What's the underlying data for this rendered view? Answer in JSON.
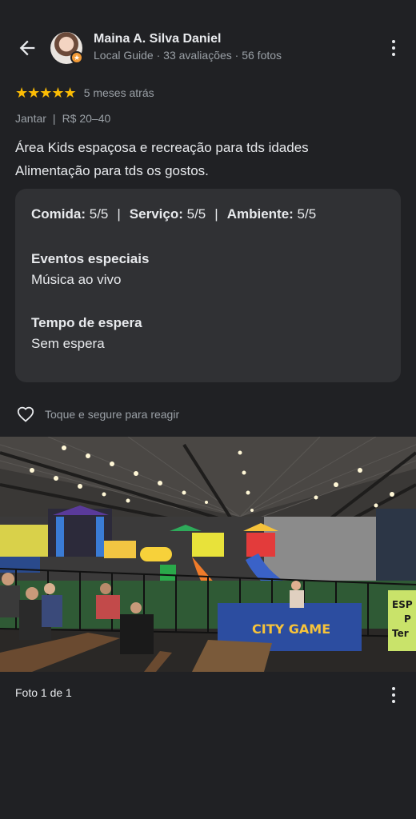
{
  "reviewer": {
    "name": "Maina A. Silva Daniel",
    "meta": "Local Guide · 33 avaliações · 56 fotos"
  },
  "icons": {
    "back": "arrow-back-icon",
    "more": "more-vertical-icon",
    "heart": "heart-outline-icon",
    "badge": "local-guide-star-icon"
  },
  "rating": {
    "stars_text": "★★★★★",
    "stars": 5,
    "max_stars": 5,
    "time": "5 meses atrás"
  },
  "tags": {
    "meal": "Jantar",
    "separator": "|",
    "price": "R$ 20–40"
  },
  "review_text": {
    "line1": "Área Kids espaçosa e recreação para tds idades",
    "line2": "Alimentação para tds os gostos."
  },
  "scores": {
    "food_label": "Comida:",
    "food_value": "5/5",
    "service_label": "Serviço:",
    "service_value": "5/5",
    "atmosphere_label": "Ambiente:",
    "atmosphere_value": "5/5",
    "separator": "|"
  },
  "details": [
    {
      "title": "Eventos especiais",
      "value": "Música ao vivo"
    },
    {
      "title": "Tempo de espera",
      "value": "Sem espera"
    }
  ],
  "reaction": {
    "label": "Toque e segure para reagir"
  },
  "photo": {
    "sign_line1": "ESP",
    "sign_line2": "P",
    "sign_line3": "Ter",
    "banner": "CITY GAME"
  },
  "footer": {
    "photo_counter": "Foto 1 de 1"
  },
  "colors": {
    "background": "#202124",
    "card": "#303134",
    "star": "#fbbc04",
    "secondary_text": "#9aa0a6"
  }
}
